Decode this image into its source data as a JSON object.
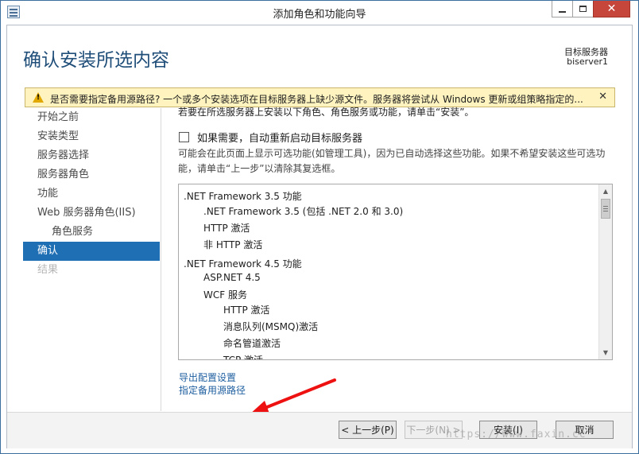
{
  "window": {
    "title": "添加角色和功能向导",
    "close_glyph": "✕"
  },
  "header": {
    "page_title": "确认安装所选内容",
    "dest_label": "目标服务器",
    "dest_value": "biserver1"
  },
  "warning": {
    "text": "是否需要指定备用源路径? 一个或多个安装选项在目标服务器上缺少源文件。服务器将尝试从 Windows 更新或组策略指定的...",
    "close_glyph": "✕"
  },
  "nav": {
    "items": [
      {
        "label": "开始之前"
      },
      {
        "label": "安装类型"
      },
      {
        "label": "服务器选择"
      },
      {
        "label": "服务器角色"
      },
      {
        "label": "功能"
      },
      {
        "label": "Web 服务器角色(IIS)"
      },
      {
        "label": "角色服务"
      },
      {
        "label": "确认"
      },
      {
        "label": "结果"
      }
    ]
  },
  "content": {
    "intro": "若要在所选服务器上安装以下角色、角色服务或功能，请单击“安装”。",
    "restart_label": "如果需要，自动重新启动目标服务器",
    "info": "可能会在此页面上显示可选功能(如管理工具)，因为已自动选择这些功能。如果不希望安装这些可选功能，请单击“上一步”以清除其复选框。",
    "features": [
      {
        "label": ".NET Framework 3.5 功能"
      },
      {
        "label": ".NET Framework 3.5 (包括 .NET 2.0 和 3.0)"
      },
      {
        "label": "HTTP 激活"
      },
      {
        "label": "非 HTTP 激活"
      },
      {
        "label": ".NET Framework 4.5 功能"
      },
      {
        "label": "ASP.NET 4.5"
      },
      {
        "label": "WCF 服务"
      },
      {
        "label": "HTTP 激活"
      },
      {
        "label": "消息队列(MSMQ)激活"
      },
      {
        "label": "命名管道激活"
      },
      {
        "label": "TCP 激活"
      }
    ],
    "export_link": "导出配置设置",
    "source_link": "指定备用源路径"
  },
  "footer": {
    "prev": "< 上一步(P)",
    "next": "下一步(N) >",
    "install": "安装(I)",
    "cancel": "取消"
  },
  "watermark": "https://www.faxin.cc"
}
